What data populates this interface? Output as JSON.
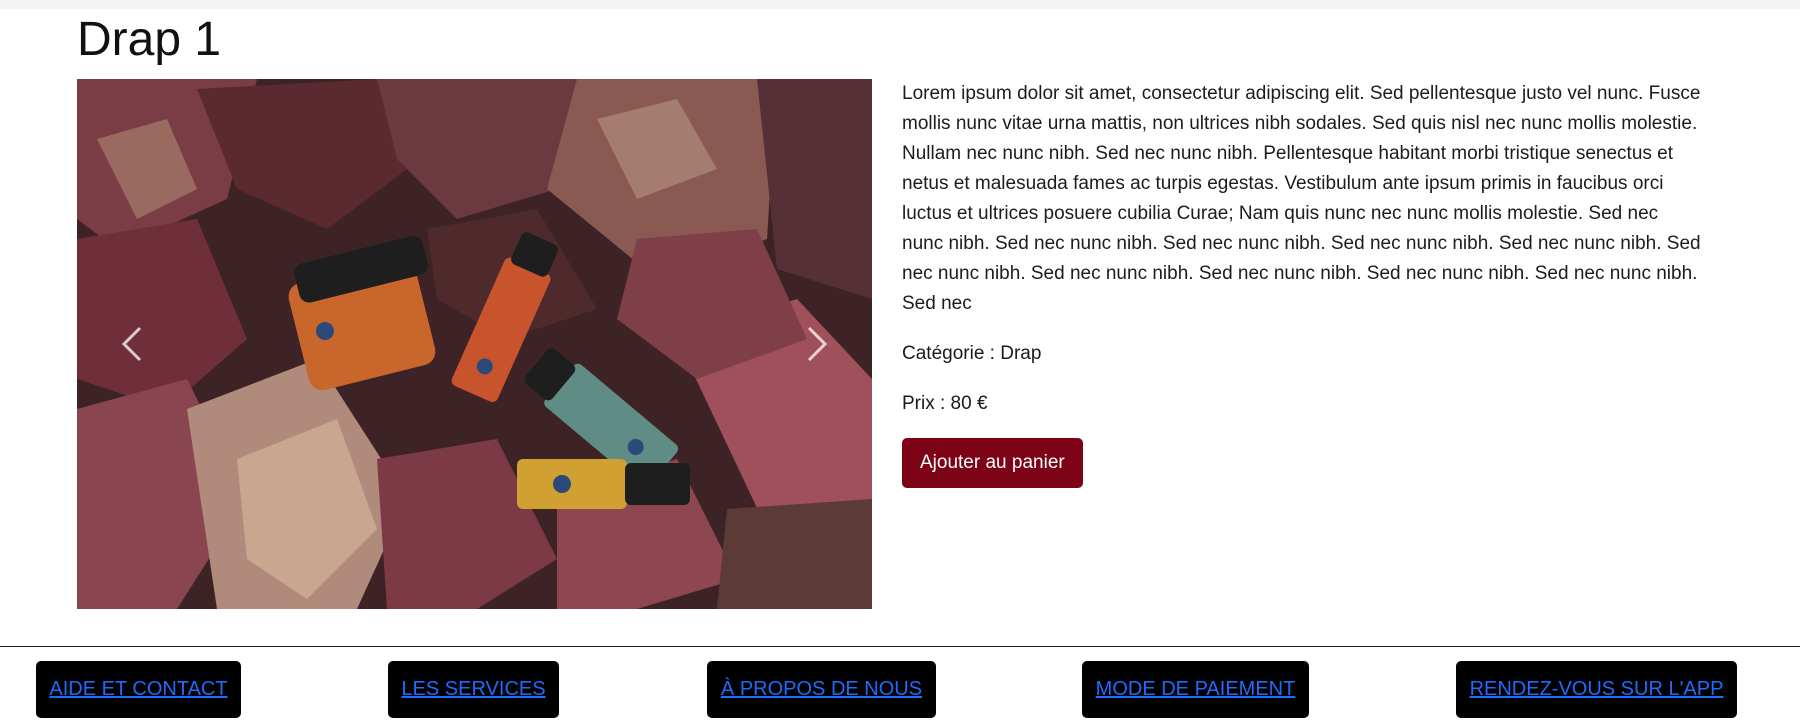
{
  "product": {
    "title": "Drap 1",
    "description": "Lorem ipsum dolor sit amet, consectetur adipiscing elit. Sed pellentesque justo vel nunc. Fusce mollis nunc vitae urna mattis, non ultrices nibh sodales. Sed quis nisl nec nunc mollis molestie. Nullam nec nunc nibh. Sed nec nunc nibh. Pellentesque habitant morbi tristique senectus et netus et malesuada fames ac turpis egestas. Vestibulum ante ipsum primis in faucibus orci luctus et ultrices posuere cubilia Curae; Nam quis nunc nec nunc mollis molestie. Sed nec nunc nibh. Sed nec nunc nibh. Sed nec nunc nibh. Sed nec nunc nibh. Sed nec nunc nibh. Sed nec nunc nibh. Sed nec nunc nibh. Sed nec nunc nibh. Sed nec nunc nibh. Sed nec nunc nibh. Sed nec",
    "category": "Catégorie : Drap",
    "price": "Prix : 80 €",
    "add_to_cart": "Ajouter au panier"
  },
  "carousel": {
    "image_label": "Blue Ridge Hemp Co products on autumn leaves",
    "prev_icon": "chevron-left-icon",
    "next_icon": "chevron-right-icon"
  },
  "footer": {
    "links": [
      "AIDE ET CONTACT",
      "LES SERVICES",
      "À PROPOS DE NOUS",
      "MODE DE PAIEMENT",
      "RENDEZ-VOUS SUR L'APP"
    ]
  },
  "colors": {
    "button_bg": "#7d0317",
    "footer_button_bg": "#000000",
    "footer_link": "#1e6bff"
  }
}
